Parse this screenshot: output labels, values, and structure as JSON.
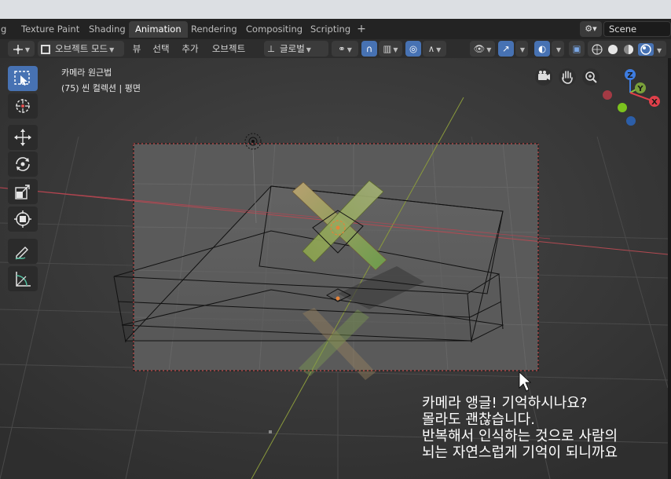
{
  "tabs": [
    "g",
    "Texture Paint",
    "Shading",
    "Animation",
    "Rendering",
    "Compositing",
    "Scripting"
  ],
  "active_tab": "Animation",
  "scene_name": "Scene",
  "header": {
    "mode": "오브젝트 모드",
    "menu_view": "뷰",
    "menu_select": "선택",
    "menu_add": "추가",
    "menu_object": "오브젝트",
    "orientation": "글로벌"
  },
  "viewport": {
    "view_name": "카메라 원근법",
    "collection_info": "(75) 씬 컬렉션 | 평면"
  },
  "gizmo_axes": {
    "x": "X",
    "y": "Y",
    "z": "Z"
  },
  "caption": [
    "카메라 앵글! 기억하시나요?",
    "몰라도 괜찮습니다.",
    "반복해서 인식하는 것으로 사람의",
    "뇌는 자연스럽게 기억이 되니까요"
  ],
  "colors": {
    "accent": "#4772b3",
    "x_axis": "#e0404a",
    "y_axis": "#8dc43c",
    "z_axis": "#3d7ce0"
  }
}
